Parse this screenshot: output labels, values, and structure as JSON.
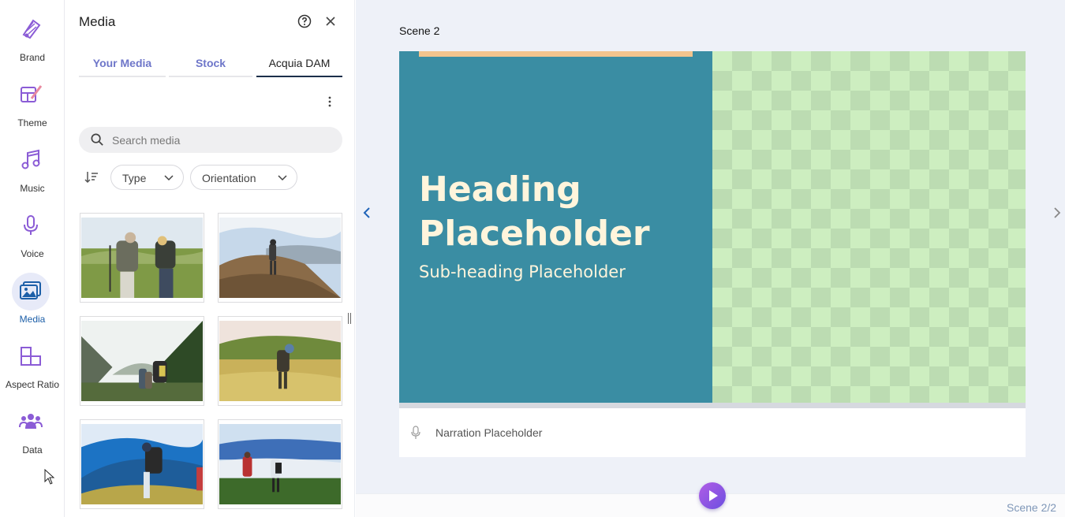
{
  "rail": {
    "items": [
      {
        "label": "Brand",
        "icon": "brand-swatch-icon"
      },
      {
        "label": "Theme",
        "icon": "theme-brush-icon"
      },
      {
        "label": "Music",
        "icon": "music-note-icon"
      },
      {
        "label": "Voice",
        "icon": "microphone-icon"
      },
      {
        "label": "Media",
        "icon": "image-gallery-icon",
        "active": true
      },
      {
        "label": "Aspect Ratio",
        "icon": "aspect-ratio-icon"
      },
      {
        "label": "Data",
        "icon": "users-icon"
      }
    ],
    "accent": "#8b5cd6"
  },
  "panel": {
    "title": "Media",
    "tabs": [
      {
        "label": "Your Media"
      },
      {
        "label": "Stock"
      },
      {
        "label": "Acquia DAM",
        "active": true
      }
    ],
    "search_placeholder": "Search media",
    "filters": {
      "type": "Type",
      "orientation": "Orientation"
    },
    "thumbnails": [
      {
        "description": "hiking-couple-meadow"
      },
      {
        "description": "hiker-hillside-slope"
      },
      {
        "description": "hiking-group-valley"
      },
      {
        "description": "hiker-tall-grass"
      },
      {
        "description": "hikers-blue-mountains"
      },
      {
        "description": "hikers-lake-view"
      }
    ]
  },
  "stage": {
    "scene_label": "Scene 2",
    "slide": {
      "heading": "Heading Placeholder",
      "subheading": "Sub-heading Placeholder",
      "colors": {
        "left": "#3a8da3",
        "accent_bar": "#f2c48e",
        "text": "#fff5dc",
        "checker_light": "#cdeec0",
        "checker_dark": "#bcdcb2"
      }
    },
    "narration": "Narration Placeholder",
    "scene_count": "Scene 2/2"
  }
}
